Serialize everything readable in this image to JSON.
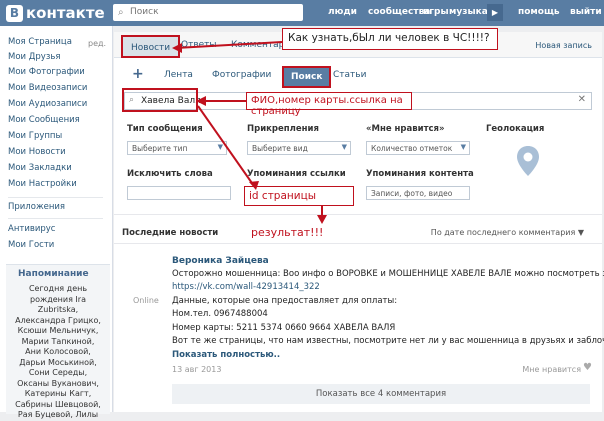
{
  "header": {
    "logo": "контакте",
    "logo_b": "В",
    "search_placeholder": "Поиск",
    "nav": [
      "люди",
      "сообщества",
      "игры",
      "музыка",
      "помощь",
      "выйти"
    ]
  },
  "sidebar": {
    "items": [
      "Моя Страница",
      "Мои Друзья",
      "Мои Фотографии",
      "Мои Видеозаписи",
      "Мои Аудиозаписи",
      "Мои Сообщения",
      "Мои Группы",
      "Мои Новости",
      "Мои Закладки",
      "Мои Настройки"
    ],
    "edit": "ред.",
    "apps": "Приложения",
    "extra": [
      "Антивирус",
      "Мои Гости"
    ],
    "reminder_title": "Напоминание",
    "reminder_lines": [
      "Сегодня день",
      "рождения Ira",
      "Zubritska,",
      "Александра Грицко,",
      "Ксюши Мельничук,",
      "Марии Тапкиной,",
      "Ани Колосовой,",
      "Дарьи Моськиной,",
      "Сони Середы,",
      "Оксаны Вуканович,",
      "Катерины Кагт,",
      "Сабрины Шевцовой,",
      "Рая Буцевой, Лилы"
    ]
  },
  "tabs": {
    "news": "Новости",
    "answers": "Ответы",
    "comments": "Комментари",
    "new_post": "Новая запись"
  },
  "subnav": {
    "plus": "+",
    "feed": "Лента",
    "photos": "Фотографии",
    "search": "Поиск",
    "articles": "Статьи"
  },
  "query": {
    "value": "Хавела Валя",
    "clear": "✕"
  },
  "filters": {
    "type_label": "Тип сообщения",
    "type_value": "Выберите тип",
    "attach_label": "Прикрепления",
    "attach_value": "Выберите вид",
    "likes_label": "«Мне нравится»",
    "likes_value": "Количество отметок",
    "geo_label": "Геолокация",
    "exclude_label": "Исключить слова",
    "mentions_label": "Упоминания ссылки",
    "content_mentions_label": "Упоминания контента",
    "content_mentions_placeholder": "Записи, фото, видео"
  },
  "news": {
    "heading": "Последние новости",
    "sort": "По дате последнего комментария",
    "online": "Online",
    "author": "Вероника Зайцева",
    "lines": [
      "Осторожно мошенница: Воо инфо о ВОРОВКЕ и МОШЕННИЦЕ ХАВЕЛЕ ВАЛЕ можно посмотреть здесь:",
      "Данные, которые она предоставляет для оплаты:",
      "Ном.тел. 0967488004",
      "Номер карты: 5211 5374 0660 9664 ХАВЕЛА ВАЛЯ",
      "Вот те же страницы, что нам известны, посмотрите нет ли у вас мошенница в друзьях и заблоче:"
    ],
    "link": "https://vk.com/wall-42913414_322",
    "more": "Показать полностью..",
    "date": "13 авг 2013",
    "likes": "Мне нравится",
    "show_all": "Показать все 4 комментария"
  },
  "annotations": {
    "question": "Как узнать,бЫл ли человек в ЧС!!!!?",
    "hint": "ФИО,номер карты.ссылка на страницу",
    "id": "id страницы",
    "result": "результат!!!"
  },
  "colors": {
    "header": "#597da3",
    "annotation": "#c0111e",
    "link": "#2b587a"
  }
}
